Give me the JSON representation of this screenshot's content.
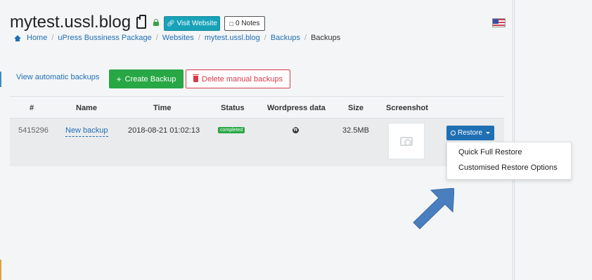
{
  "header": {
    "site_title": "mytest.ussl.blog",
    "visit_button": "Visit Website",
    "notes_button": "0 Notes"
  },
  "breadcrumb": [
    "Home",
    "uPress Bussiness Package",
    "Websites",
    "mytest.ussl.blog",
    "Backups",
    "Backups"
  ],
  "actions": {
    "auto_backups_link": "View automatic backups",
    "create_button": "Create Backup",
    "delete_button": "Delete manual backups"
  },
  "table": {
    "headers": [
      "#",
      "Name",
      "Time",
      "Status",
      "Wordpress data",
      "Size",
      "Screenshot"
    ],
    "rows": [
      {
        "id": "5415296",
        "name": "New backup",
        "time": "2018-08-21 01:02:13",
        "status": "completed",
        "size": "32.5MB"
      }
    ]
  },
  "restore": {
    "button": "Restore",
    "menu": [
      "Quick Full Restore",
      "Customised Restore Options"
    ]
  },
  "colors": {
    "primary": "#1f6fb4",
    "success": "#28a745",
    "info": "#17a2b8",
    "danger": "#d73a49",
    "arrow": "#4a7fbf"
  },
  "icons": [
    "clipboard-icon",
    "lock-icon",
    "link-icon",
    "note-icon",
    "flag-us-icon",
    "home-icon",
    "plus-icon",
    "trash-icon",
    "wordpress-icon",
    "camera-icon",
    "restore-icon",
    "chevron-down-icon",
    "arrow-icon"
  ]
}
